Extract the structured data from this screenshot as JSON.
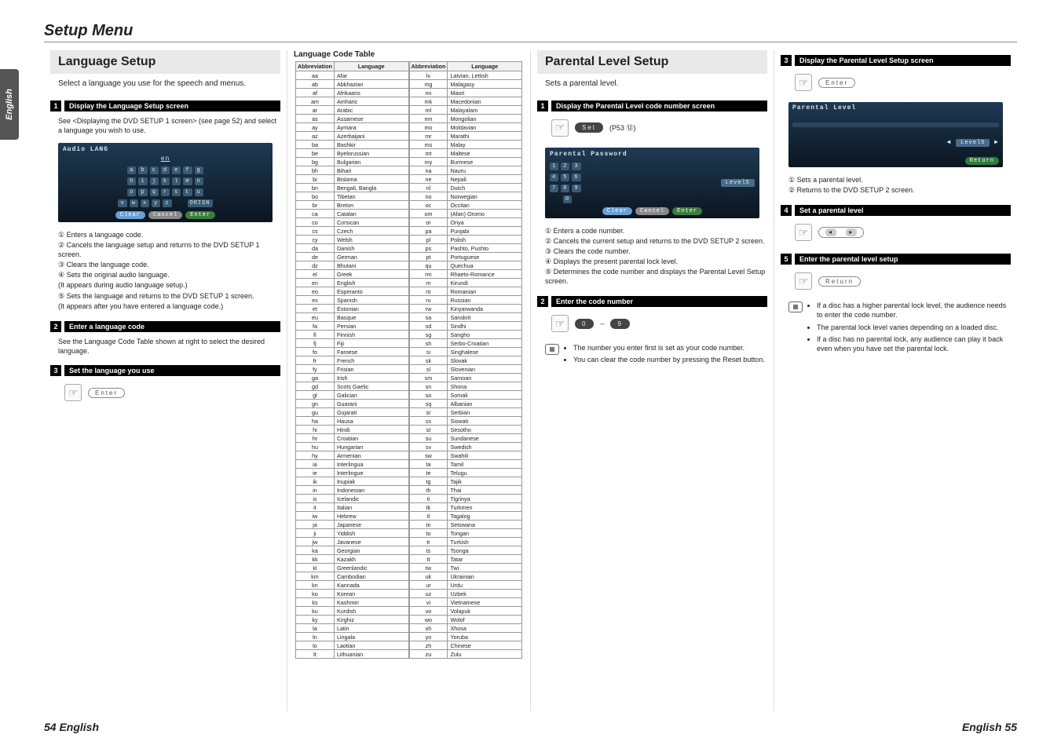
{
  "page_tab": "English",
  "setup_title": "Setup Menu",
  "footer_left": "54 English",
  "footer_right": "English 55",
  "col1": {
    "section_title": "Language Setup",
    "intro": "Select a language you use for the speech and menus.",
    "step1_num": "1",
    "step1_title": "Display the Language Setup screen",
    "step1_body": "See <Displaying the DVD SETUP 1 screen> (see page 52) and select a language you wish to use.",
    "sc": {
      "title": "Audio LANG",
      "under": "en",
      "rows": [
        [
          "a",
          "b",
          "c",
          "d",
          "e",
          "f",
          "g"
        ],
        [
          "h",
          "i",
          "j",
          "k",
          "l",
          "m",
          "n"
        ],
        [
          "o",
          "p",
          "q",
          "r",
          "s",
          "t",
          "u"
        ],
        [
          "v",
          "w",
          "x",
          "y",
          "z",
          "",
          "ORIGN"
        ]
      ],
      "clear": "Clear",
      "cancel": "Cancel",
      "enter": "Enter"
    },
    "list": [
      "① Enters a language code.",
      "② Cancels the language setup and returns to the DVD SETUP 1 screen.",
      "③ Clears the language code.",
      "④ Sets the original audio language.",
      "   (It appears during audio language setup.)",
      "⑤ Sets the language and returns to the DVD SETUP 1 screen.",
      "   (It appears after you have entered a language code.)"
    ],
    "step2_num": "2",
    "step2_title": "Enter a language code",
    "step2_body": "See the Language Code Table shown at right to select the desired language.",
    "step3_num": "3",
    "step3_title": "Set the language you use",
    "enter_pill": "Enter"
  },
  "col2": {
    "table_title": "Language Code Table",
    "h_abbr": "Abbreviation",
    "h_lang": "Language",
    "left": [
      [
        "aa",
        "Afar"
      ],
      [
        "ab",
        "Abkhazian"
      ],
      [
        "af",
        "Afrikaans"
      ],
      [
        "am",
        "Amharic"
      ],
      [
        "ar",
        "Arabic"
      ],
      [
        "as",
        "Assamese"
      ],
      [
        "ay",
        "Aymara"
      ],
      [
        "az",
        "Azerbaijani"
      ],
      [
        "ba",
        "Bashkir"
      ],
      [
        "be",
        "Byelorussian"
      ],
      [
        "bg",
        "Bulgarian"
      ],
      [
        "bh",
        "Bihari"
      ],
      [
        "bi",
        "Bislama"
      ],
      [
        "bn",
        "Bengali, Bangla"
      ],
      [
        "bo",
        "Tibetan"
      ],
      [
        "br",
        "Breton"
      ],
      [
        "ca",
        "Catalan"
      ],
      [
        "co",
        "Corsican"
      ],
      [
        "cs",
        "Czech"
      ],
      [
        "cy",
        "Welsh"
      ],
      [
        "da",
        "Danish"
      ],
      [
        "de",
        "German"
      ],
      [
        "dz",
        "Bhutani"
      ],
      [
        "el",
        "Greek"
      ],
      [
        "en",
        "English"
      ],
      [
        "eo",
        "Esperanto"
      ],
      [
        "es",
        "Spanish"
      ],
      [
        "et",
        "Estonian"
      ],
      [
        "eu",
        "Basque"
      ],
      [
        "fa",
        "Persian"
      ],
      [
        "fi",
        "Finnish"
      ],
      [
        "fj",
        "Fiji"
      ],
      [
        "fo",
        "Faroese"
      ],
      [
        "fr",
        "French"
      ],
      [
        "fy",
        "Frisian"
      ],
      [
        "ga",
        "Irish"
      ],
      [
        "gd",
        "Scots Gaelic"
      ],
      [
        "gl",
        "Galician"
      ],
      [
        "gn",
        "Guarani"
      ],
      [
        "gu",
        "Gujarati"
      ],
      [
        "ha",
        "Hausa"
      ],
      [
        "hi",
        "Hindi"
      ],
      [
        "hr",
        "Croatian"
      ],
      [
        "hu",
        "Hungarian"
      ],
      [
        "hy",
        "Armenian"
      ],
      [
        "ia",
        "Interlingua"
      ],
      [
        "ie",
        "Interlingue"
      ],
      [
        "ik",
        "Inupiak"
      ],
      [
        "in",
        "Indonesian"
      ],
      [
        "is",
        "Icelandic"
      ],
      [
        "it",
        "Italian"
      ],
      [
        "iw",
        "Hebrew"
      ],
      [
        "ja",
        "Japanese"
      ],
      [
        "ji",
        "Yiddish"
      ],
      [
        "jw",
        "Javanese"
      ],
      [
        "ka",
        "Georgian"
      ],
      [
        "kk",
        "Kazakh"
      ],
      [
        "kl",
        "Greenlandic"
      ],
      [
        "km",
        "Cambodian"
      ],
      [
        "kn",
        "Kannada"
      ],
      [
        "ko",
        "Korean"
      ],
      [
        "ks",
        "Kashmiri"
      ],
      [
        "ku",
        "Kurdish"
      ],
      [
        "ky",
        "Kirghiz"
      ],
      [
        "la",
        "Latin"
      ],
      [
        "ln",
        "Lingala"
      ],
      [
        "lo",
        "Laotian"
      ],
      [
        "lt",
        "Lithuanian"
      ]
    ],
    "right": [
      [
        "lv",
        "Latvian, Lettish"
      ],
      [
        "mg",
        "Malagasy"
      ],
      [
        "mi",
        "Maori"
      ],
      [
        "mk",
        "Macedonian"
      ],
      [
        "ml",
        "Malayalam"
      ],
      [
        "mn",
        "Mongolian"
      ],
      [
        "mo",
        "Moldavian"
      ],
      [
        "mr",
        "Marathi"
      ],
      [
        "ms",
        "Malay"
      ],
      [
        "mt",
        "Maltese"
      ],
      [
        "my",
        "Burmese"
      ],
      [
        "na",
        "Nauru"
      ],
      [
        "ne",
        "Nepali"
      ],
      [
        "nl",
        "Dutch"
      ],
      [
        "no",
        "Norwegian"
      ],
      [
        "oc",
        "Occitan"
      ],
      [
        "om",
        "(Afan) Oromo"
      ],
      [
        "or",
        "Oriya"
      ],
      [
        "pa",
        "Punjabi"
      ],
      [
        "pl",
        "Polish"
      ],
      [
        "ps",
        "Pashto, Pushto"
      ],
      [
        "pt",
        "Portuguese"
      ],
      [
        "qu",
        "Quechua"
      ],
      [
        "rm",
        "Rhaeto-Romance"
      ],
      [
        "rn",
        "Kirundi"
      ],
      [
        "ro",
        "Romanian"
      ],
      [
        "ru",
        "Russian"
      ],
      [
        "rw",
        "Kinyarwanda"
      ],
      [
        "sa",
        "Sanskrit"
      ],
      [
        "sd",
        "Sindhi"
      ],
      [
        "sg",
        "Sangho"
      ],
      [
        "sh",
        "Serbo-Croatian"
      ],
      [
        "si",
        "Singhalese"
      ],
      [
        "sk",
        "Slovak"
      ],
      [
        "sl",
        "Slovenian"
      ],
      [
        "sm",
        "Samoan"
      ],
      [
        "sn",
        "Shona"
      ],
      [
        "so",
        "Somali"
      ],
      [
        "sq",
        "Albanian"
      ],
      [
        "sr",
        "Serbian"
      ],
      [
        "ss",
        "Siswati"
      ],
      [
        "st",
        "Sesotho"
      ],
      [
        "su",
        "Sundanese"
      ],
      [
        "sv",
        "Swedish"
      ],
      [
        "sw",
        "Swahili"
      ],
      [
        "ta",
        "Tamil"
      ],
      [
        "te",
        "Telugu"
      ],
      [
        "tg",
        "Tajik"
      ],
      [
        "th",
        "Thai"
      ],
      [
        "ti",
        "Tigrinya"
      ],
      [
        "tk",
        "Turkmen"
      ],
      [
        "tl",
        "Tagalog"
      ],
      [
        "tn",
        "Setswana"
      ],
      [
        "to",
        "Tongan"
      ],
      [
        "tr",
        "Turkish"
      ],
      [
        "ts",
        "Tsonga"
      ],
      [
        "tt",
        "Tatar"
      ],
      [
        "tw",
        "Twi"
      ],
      [
        "uk",
        "Ukrainian"
      ],
      [
        "ur",
        "Urdu"
      ],
      [
        "uz",
        "Uzbek"
      ],
      [
        "vi",
        "Vietnamese"
      ],
      [
        "vo",
        "Volapuk"
      ],
      [
        "wo",
        "Wolof"
      ],
      [
        "xh",
        "Xhosa"
      ],
      [
        "yo",
        "Yoruba"
      ],
      [
        "zh",
        "Chinese"
      ],
      [
        "zu",
        "Zulu"
      ]
    ]
  },
  "col3": {
    "section_title": "Parental Level Setup",
    "intro": "Sets a parental level.",
    "step1_num": "1",
    "step1_title": "Display the Parental Level code number screen",
    "set_pill": "Set",
    "p53": "(P53 ⑫)",
    "sc": {
      "title": "Parental Password",
      "rows": [
        [
          "1",
          "2",
          "3"
        ],
        [
          "4",
          "5",
          "6"
        ],
        [
          "7",
          "8",
          "9"
        ],
        [
          "",
          "0",
          ""
        ]
      ],
      "level": "Level5",
      "clear": "Clear",
      "cancel": "Cancel",
      "enter": "Enter"
    },
    "list": [
      "① Enters a code number.",
      "② Cancels the current setup and returns to the DVD SETUP 2 screen.",
      "③ Clears the code number.",
      "④ Displays the present parental lock level.",
      "⑤ Determines the code number and displays the Parental Level Setup screen."
    ],
    "step2_num": "2",
    "step2_title": "Enter the code number",
    "digits": [
      "0",
      "9"
    ],
    "notes": [
      "The number you enter first is set as your code number.",
      "You can clear the code number by pressing the Reset button."
    ]
  },
  "col4": {
    "step3_num": "3",
    "step3_title": "Display the Parental Level Setup screen",
    "enter_pill": "Enter",
    "sc": {
      "title": "Parental Level",
      "level": "Level5",
      "return": "Return"
    },
    "list": [
      "① Sets a parental level.",
      "② Returns to the DVD SETUP 2 screen."
    ],
    "step4_num": "4",
    "step4_title": "Set a parental level",
    "step5_num": "5",
    "step5_title": "Enter the parental level setup",
    "return_pill": "Return",
    "notes": [
      "If a disc has a higher parental lock level, the audience needs to enter the code number.",
      "The parental lock level varies depending on a loaded disc.",
      "If a disc has no parental lock, any audience can play it back even when you have set the parental lock."
    ]
  }
}
